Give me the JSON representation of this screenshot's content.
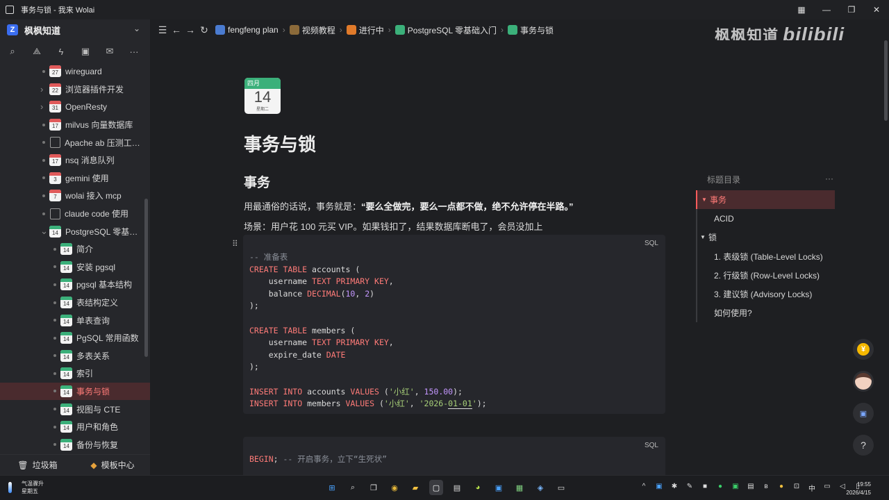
{
  "window": {
    "title": "事务与锁 - 我来 Wolai"
  },
  "workspace": {
    "name": "枫枫知道",
    "logo": "Z"
  },
  "sidebar": {
    "tools": [
      "search-icon",
      "graph-icon",
      "flash-icon",
      "template-icon",
      "inbox-icon",
      "more-icon"
    ],
    "items": [
      {
        "label": "wireguard",
        "icon": "cal",
        "icon_text": "27",
        "level": 1,
        "caret": "none"
      },
      {
        "label": "浏览器插件开发",
        "icon": "cal",
        "icon_text": "22",
        "level": 1,
        "caret": "right"
      },
      {
        "label": "OpenResty",
        "icon": "cal",
        "icon_text": "31",
        "level": 1,
        "caret": "right"
      },
      {
        "label": "milvus 向量数据库",
        "icon": "cal",
        "icon_text": "17",
        "level": 1,
        "caret": "none"
      },
      {
        "label": "Apache ab 压测工具...",
        "icon": "doc",
        "icon_text": "",
        "level": 1,
        "caret": "none"
      },
      {
        "label": "nsq 消息队列",
        "icon": "cal",
        "icon_text": "17",
        "level": 1,
        "caret": "none"
      },
      {
        "label": "gemini 使用",
        "icon": "cal",
        "icon_text": "3",
        "level": 1,
        "caret": "none"
      },
      {
        "label": "wolai 接入 mcp",
        "icon": "cal",
        "icon_text": "7",
        "level": 1,
        "caret": "none"
      },
      {
        "label": "claude code 使用",
        "icon": "doc",
        "icon_text": "",
        "level": 1,
        "caret": "none"
      },
      {
        "label": "PostgreSQL 零基础入...",
        "icon": "calg",
        "icon_text": "14",
        "level": 1,
        "caret": "down"
      },
      {
        "label": "简介",
        "icon": "calg",
        "icon_text": "14",
        "level": 2,
        "caret": "none"
      },
      {
        "label": "安装 pgsql",
        "icon": "calg",
        "icon_text": "14",
        "level": 2,
        "caret": "none"
      },
      {
        "label": "pgsql 基本结构",
        "icon": "calg",
        "icon_text": "14",
        "level": 2,
        "caret": "none"
      },
      {
        "label": "表结构定义",
        "icon": "calg",
        "icon_text": "14",
        "level": 2,
        "caret": "none"
      },
      {
        "label": "单表查询",
        "icon": "calg",
        "icon_text": "14",
        "level": 2,
        "caret": "none"
      },
      {
        "label": "PgSQL 常用函数",
        "icon": "calg",
        "icon_text": "14",
        "level": 2,
        "caret": "none"
      },
      {
        "label": "多表关系",
        "icon": "calg",
        "icon_text": "14",
        "level": 2,
        "caret": "none"
      },
      {
        "label": "索引",
        "icon": "calg",
        "icon_text": "14",
        "level": 2,
        "caret": "none"
      },
      {
        "label": "事务与锁",
        "icon": "calg",
        "icon_text": "14",
        "level": 2,
        "caret": "none",
        "active": true
      },
      {
        "label": "视图与 CTE",
        "icon": "calg",
        "icon_text": "14",
        "level": 2,
        "caret": "none"
      },
      {
        "label": "用户和角色",
        "icon": "calg",
        "icon_text": "14",
        "level": 2,
        "caret": "none"
      },
      {
        "label": "备份与恢复",
        "icon": "calg",
        "icon_text": "14",
        "level": 2,
        "caret": "none"
      }
    ],
    "trash_label": "垃圾箱",
    "templates_label": "模板中心"
  },
  "breadcrumb": [
    {
      "label": "fengfeng plan",
      "color": "#4a7bd0"
    },
    {
      "label": "视频教程",
      "color": "#8b6a3a"
    },
    {
      "label": "进行中",
      "color": "#e07a2a"
    },
    {
      "label": "PostgreSQL 零基础入门",
      "color": "#3bb07a"
    },
    {
      "label": "事务与锁",
      "color": "#3bb07a"
    }
  ],
  "brand": {
    "text": "枫枫知道",
    "bili": "bilibili"
  },
  "page": {
    "date_month": "四月",
    "date_day": "14",
    "date_week": "星期二",
    "title": "事务与锁",
    "section1": "事务",
    "para1_prefix": "用最通俗的话说，事务就是：",
    "para1_bold": "“要么全做完，要么一点都不做，绝不允许停在半路。”",
    "para2": "场景：用户花 100 元买 VIP。如果钱扣了，结果数据库断电了，会员没加上"
  },
  "code1": {
    "lang": "SQL",
    "comment": "-- 准备表",
    "l_create1a": "CREATE TABLE",
    "l_create1b": " accounts (",
    "l_user_a": "    username ",
    "l_user_b": "TEXT PRIMARY KEY",
    "l_bal_a": "    balance ",
    "l_bal_b": "DECIMAL",
    "l_bal_c": "10",
    "l_bal_d": "2",
    "l_close": ");",
    "l_create2b": " members (",
    "l_exp_a": "    expire_date ",
    "l_exp_b": "DATE",
    "l_ins": "INSERT INTO",
    "l_ins1_tbl": " accounts ",
    "l_values": "VALUES",
    "l_str1": "'小红'",
    "l_num1": "150.00",
    "l_ins2_tbl": " members ",
    "l_str2a": "'2026-",
    "l_str2b": "01-01",
    "l_str2c": "'"
  },
  "code2": {
    "lang": "SQL",
    "begin": "BEGIN",
    "comment": " -- 开启事务，立下“生死状”"
  },
  "toc": {
    "title": "标题目录",
    "items": [
      {
        "label": "事务",
        "level": 1,
        "caret": "▼",
        "active": true
      },
      {
        "label": "ACID",
        "level": 2,
        "caret": ""
      },
      {
        "label": "锁",
        "level": 1,
        "caret": "▼"
      },
      {
        "label": "1. 表级锁 (Table-Level Locks)",
        "level": 2,
        "caret": ""
      },
      {
        "label": "2. 行级锁 (Row-Level Locks)",
        "level": 2,
        "caret": ""
      },
      {
        "label": "3. 建议锁 (Advisory Locks)",
        "level": 2,
        "caret": ""
      },
      {
        "label": "如何使用?",
        "level": 2,
        "caret": ""
      }
    ]
  },
  "taskbar": {
    "weather_line1": "气温骤升",
    "weather_line2": "星期五",
    "time": "19:55",
    "date": "2026/4/15",
    "ime": "中"
  }
}
